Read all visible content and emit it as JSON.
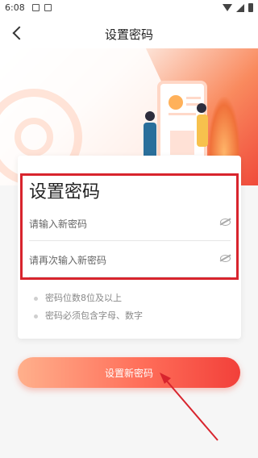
{
  "status_bar": {
    "time": "6:08"
  },
  "header": {
    "title": "设置密码"
  },
  "card": {
    "title": "设置密码",
    "new_password_placeholder": "请输入新密码",
    "confirm_password_placeholder": "请再次输入新密码",
    "hints": [
      "密码位数8位及以上",
      "密码必须包含字母、数字"
    ]
  },
  "actions": {
    "submit_label": "设置新密码"
  },
  "colors": {
    "accent": "#f2403a",
    "annotation": "#d8242d"
  }
}
